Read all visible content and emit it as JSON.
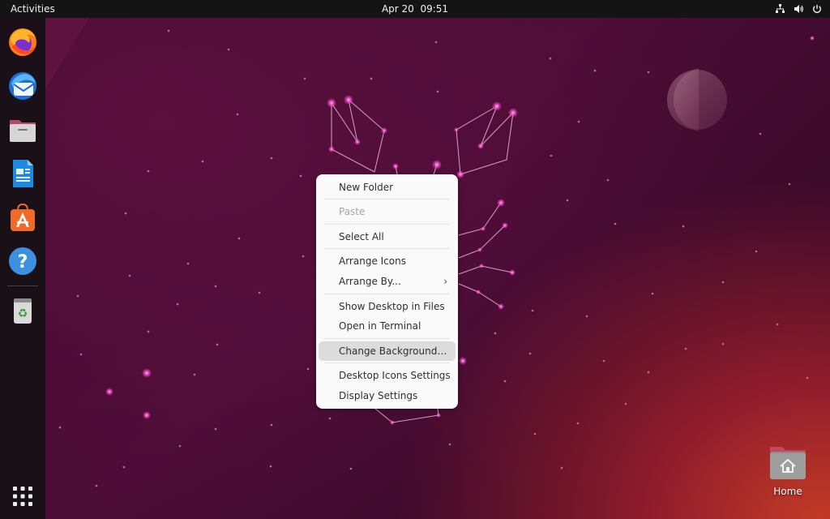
{
  "topbar": {
    "activities_label": "Activities",
    "clock": "Apr 20  09:51"
  },
  "dock": {
    "items": [
      {
        "name": "Firefox",
        "icon": "firefox-icon"
      },
      {
        "name": "Thunderbird",
        "icon": "thunderbird-icon"
      },
      {
        "name": "Files",
        "icon": "files-icon"
      },
      {
        "name": "LibreOffice Writer",
        "icon": "libreoffice-writer-icon"
      },
      {
        "name": "Ubuntu Software",
        "icon": "software-store-icon"
      },
      {
        "name": "Help",
        "icon": "help-icon"
      },
      {
        "name": "Trash",
        "icon": "trash-icon"
      },
      {
        "name": "Show Applications",
        "icon": "app-grid-icon"
      }
    ]
  },
  "context_menu": {
    "items": [
      {
        "label": "New Folder",
        "enabled": true
      },
      {
        "label": "Paste",
        "enabled": false
      },
      {
        "label": "Select All",
        "enabled": true
      },
      {
        "label": "Arrange Icons",
        "enabled": true
      },
      {
        "label": "Arrange By...",
        "enabled": true,
        "submenu": true
      },
      {
        "label": "Show Desktop in Files",
        "enabled": true
      },
      {
        "label": "Open in Terminal",
        "enabled": true
      },
      {
        "label": "Change Background…",
        "enabled": true,
        "highlighted": true
      },
      {
        "label": "Desktop Icons Settings",
        "enabled": true
      },
      {
        "label": "Display Settings",
        "enabled": true
      }
    ],
    "submenu_chevron": "›"
  },
  "desktop": {
    "home_label": "Home"
  },
  "colors": {
    "topbar": "#141414",
    "dock": "#1a1118",
    "menu_bg": "#fafafa",
    "menu_highlight": "#dcdcdc",
    "star": "#ff5fd2"
  }
}
